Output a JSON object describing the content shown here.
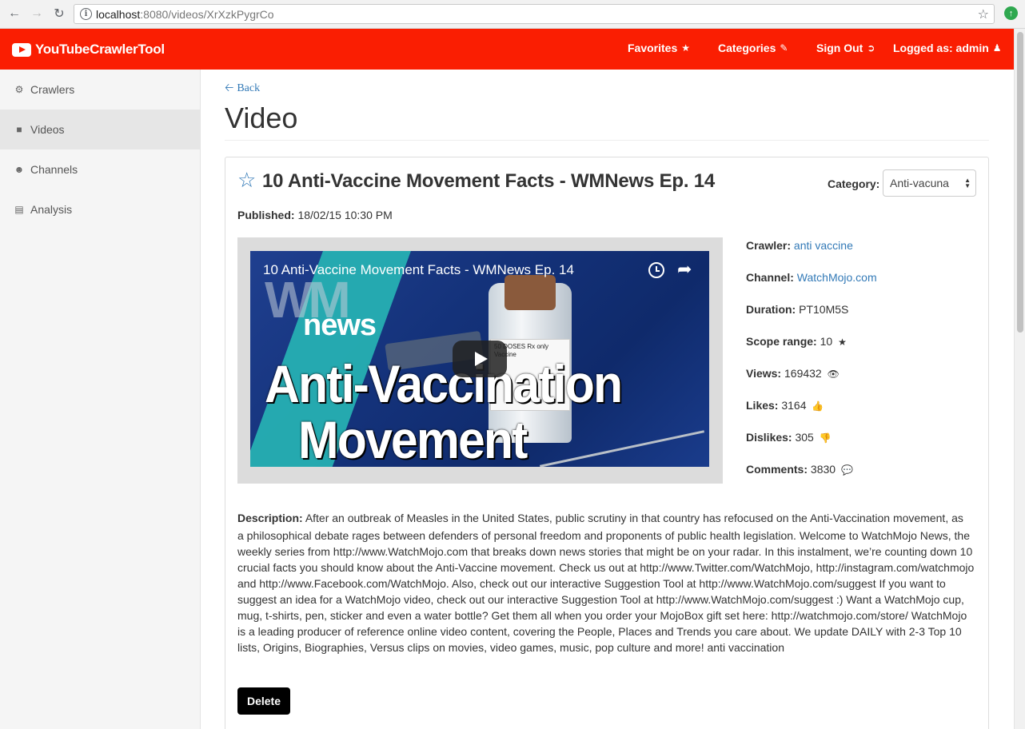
{
  "browser": {
    "url_host": "localhost",
    "url_path": ":8080/videos/XrXzkPygrCo"
  },
  "navbar": {
    "brand": "YouTubeCrawlerTool",
    "links": {
      "favorites": "Favorites",
      "categories": "Categories",
      "sign_out": "Sign Out",
      "logged_as": "Logged as: admin"
    },
    "color": "#fa1e02"
  },
  "sidebar": {
    "items": [
      {
        "label": "Crawlers",
        "icon": "cogs-icon"
      },
      {
        "label": "Videos",
        "icon": "video-camera-icon",
        "active": true
      },
      {
        "label": "Channels",
        "icon": "users-icon"
      },
      {
        "label": "Analysis",
        "icon": "bar-chart-icon"
      }
    ]
  },
  "page": {
    "back_label": "Back",
    "title": "Video"
  },
  "video": {
    "title": "10 Anti-Vaccine Movement Facts - WMNews Ep. 14",
    "category_label": "Category:",
    "category_value": "Anti-vacuna",
    "published_label": "Published:",
    "published_value": "18/02/15 10:30 PM",
    "thumbnail": {
      "overlay_title": "10 Anti-Vaccine Movement Facts - WMNews Ep. 14",
      "logo_text": "WM",
      "news_text": "news",
      "big_line_1": "Anti-Vaccination",
      "big_line_2": "Movement",
      "vial_label": "50 DOSES  Rx only  Vaccine"
    },
    "meta": {
      "crawler_label": "Crawler:",
      "crawler_value": "anti vaccine",
      "channel_label": "Channel:",
      "channel_value": "WatchMojo.com",
      "duration_label": "Duration:",
      "duration_value": "PT10M5S",
      "scope_label": "Scope range:",
      "scope_value": "10",
      "views_label": "Views:",
      "views_value": "169432",
      "likes_label": "Likes:",
      "likes_value": "3164",
      "dislikes_label": "Dislikes:",
      "dislikes_value": "305",
      "comments_label": "Comments:",
      "comments_value": "3830"
    },
    "description_label": "Description:",
    "description_first": "After an outbreak of Measles in the United States, public scrutiny in that country has refocused on the Anti-Vaccination movement, as",
    "description_rest": "a philosophical debate rages between defenders of personal freedom and proponents of public health legislation. Welcome to WatchMojo News, the weekly series from http://www.WatchMojo.com that breaks down news stories that might be on your radar. In this instalment, we’re counting down 10 crucial facts you should know about the Anti-Vaccine movement. Check us out at http://www.Twitter.com/WatchMojo, http://instagram.com/watchmojo and http://www.Facebook.com/WatchMojo. Also, check out our interactive Suggestion Tool at http://www.WatchMojo.com/suggest If you want to suggest an idea for a WatchMojo video, check out our interactive Suggestion Tool at http://www.WatchMojo.com/suggest :) Want a WatchMojo cup, mug, t-shirts, pen, sticker and even a water bottle? Get them all when you order your MojoBox gift set here: http://watchmojo.com/store/ WatchMojo is a leading producer of reference online video content, covering the People, Places and Trends you care about. We update DAILY with 2-3 Top 10 lists, Origins, Biographies, Versus clips on movies, video games, music, pop culture and more! anti vaccination",
    "delete_label": "Delete"
  }
}
